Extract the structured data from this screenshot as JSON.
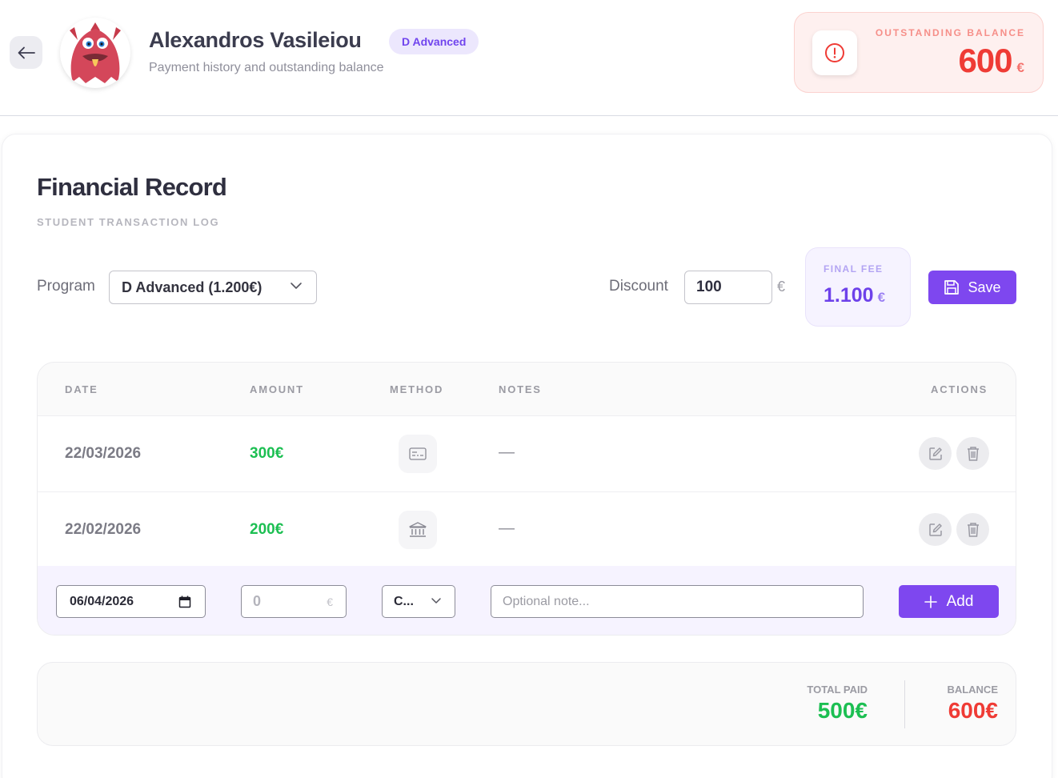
{
  "header": {
    "student_name": "Alexandros Vasileiou",
    "level_badge": "D Advanced",
    "subtitle": "Payment history and outstanding balance",
    "outstanding": {
      "label": "OUTSTANDING BALANCE",
      "value": "600",
      "currency": "€"
    }
  },
  "record": {
    "title": "Financial Record",
    "subtitle": "STUDENT TRANSACTION LOG",
    "program_label": "Program",
    "program_value": "D Advanced (1.200€)",
    "discount_label": "Discount",
    "discount_value": "100",
    "discount_currency": "€",
    "final_fee": {
      "label": "FINAL FEE",
      "value": "1.100",
      "currency": "€"
    },
    "save_label": "Save"
  },
  "table": {
    "headers": {
      "date": "DATE",
      "amount": "AMOUNT",
      "method": "METHOD",
      "notes": "NOTES",
      "actions": "ACTIONS"
    },
    "rows": [
      {
        "date": "22/03/2026",
        "amount": "300€",
        "method_icon": "card-icon",
        "notes": "—"
      },
      {
        "date": "22/02/2026",
        "amount": "200€",
        "method_icon": "bank-icon",
        "notes": "—"
      }
    ],
    "new_entry": {
      "date_value": "06/04/2026",
      "amount_placeholder": "0",
      "amount_currency": "€",
      "method_value": "C...",
      "note_placeholder": "Optional note...",
      "add_label": "Add"
    }
  },
  "totals": {
    "total_paid_label": "TOTAL PAID",
    "total_paid_value": "500€",
    "balance_label": "BALANCE",
    "balance_value": "600€"
  },
  "colors": {
    "accent": "#7e47ef",
    "paid_green": "#1cbf52",
    "balance_red": "#ef3b35"
  }
}
